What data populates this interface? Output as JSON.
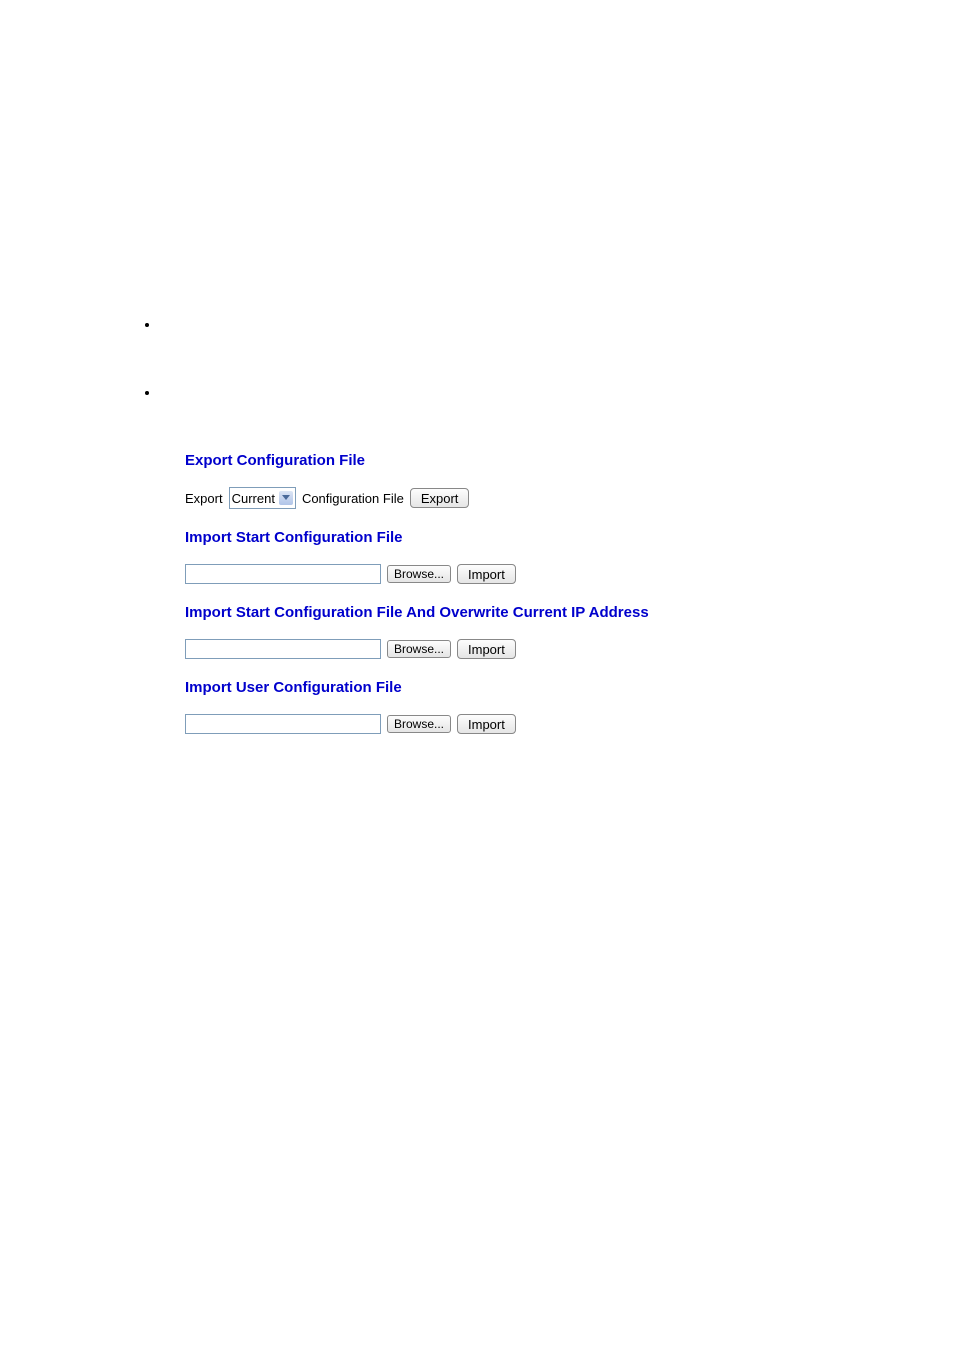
{
  "sections": {
    "export": {
      "heading": "Export Configuration File",
      "prefix_label": "Export",
      "select_value": "Current",
      "suffix_label": "Configuration File",
      "button": "Export"
    },
    "import_start": {
      "heading": "Import Start Configuration File",
      "browse": "Browse...",
      "button": "Import"
    },
    "import_overwrite": {
      "heading": "Import Start Configuration File And Overwrite Current IP Address",
      "browse": "Browse...",
      "button": "Import"
    },
    "import_user": {
      "heading": "Import User Configuration File",
      "browse": "Browse...",
      "button": "Import"
    }
  }
}
